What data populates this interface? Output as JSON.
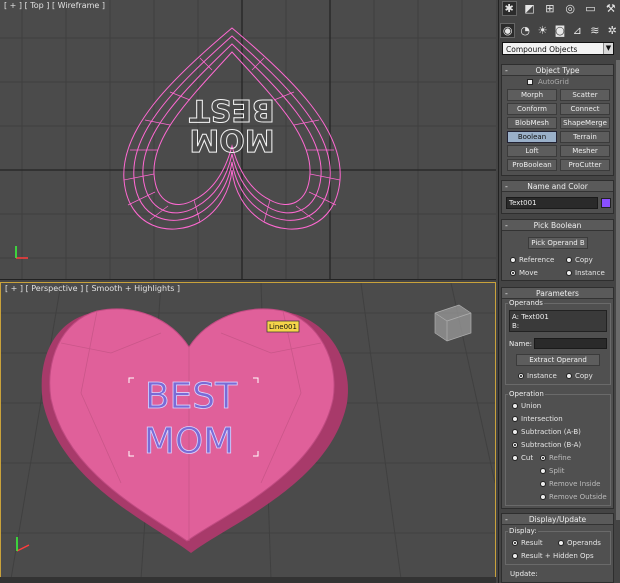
{
  "viewports": {
    "top_label": "[ + ] [ Top ] [ Wireframe ]",
    "perspective_label": "[ + ] [ Perspective ] [ Smooth + Highlights ]",
    "top_text_line1": "BEST",
    "top_text_line2": "MOM",
    "persp_text_line1": "BEST",
    "persp_text_line2": "MOM",
    "object_tooltip": "Line001"
  },
  "panel": {
    "tab_icons": [
      "create-icon",
      "modify-icon",
      "hierarchy-icon",
      "motion-icon",
      "display-icon",
      "utilities-icon"
    ],
    "category_icons": [
      "geometry-icon",
      "shapes-icon",
      "lights-icon",
      "cameras-icon",
      "helpers-icon",
      "spacewarps-icon",
      "systems-icon"
    ],
    "category_dropdown": "Compound Objects",
    "object_type": {
      "title": "Object Type",
      "autogrid": "AutoGrid",
      "buttons": [
        "Morph",
        "Scatter",
        "Conform",
        "Connect",
        "BlobMesh",
        "ShapeMerge",
        "Boolean",
        "Terrain",
        "Loft",
        "Mesher",
        "ProBoolean",
        "ProCutter"
      ]
    },
    "name_color": {
      "title": "Name and Color",
      "name": "Text001",
      "color": "#8a4fff"
    },
    "pick_boolean": {
      "title": "Pick Boolean",
      "pick_button": "Pick Operand B",
      "reference": "Reference",
      "copy": "Copy",
      "move": "Move",
      "instance": "Instance"
    },
    "parameters": {
      "title": "Parameters",
      "operands_title": "Operands",
      "operand_a": "A: Text001",
      "operand_b": "B:",
      "name_label": "Name:",
      "extract_button": "Extract Operand",
      "instance": "Instance",
      "copy": "Copy",
      "operation_title": "Operation",
      "union": "Union",
      "intersection": "Intersection",
      "sub_ab": "Subtraction (A-B)",
      "sub_ba": "Subtraction (B-A)",
      "cut": "Cut",
      "refine": "Refine",
      "split": "Split",
      "remove_inside": "Remove Inside",
      "remove_outside": "Remove Outside"
    },
    "display_update": {
      "title": "Display/Update",
      "display_label": "Display:",
      "result": "Result",
      "operands": "Operands",
      "result_hidden": "Result + Hidden Ops",
      "update_label": "Update:"
    }
  },
  "colors": {
    "viewport_bg": "#4b4b4b",
    "wireframe": "#ff69d2",
    "heart_fill": "#e0609a",
    "text_fill": "#7a6bd6",
    "active_border": "#c9a23b"
  }
}
